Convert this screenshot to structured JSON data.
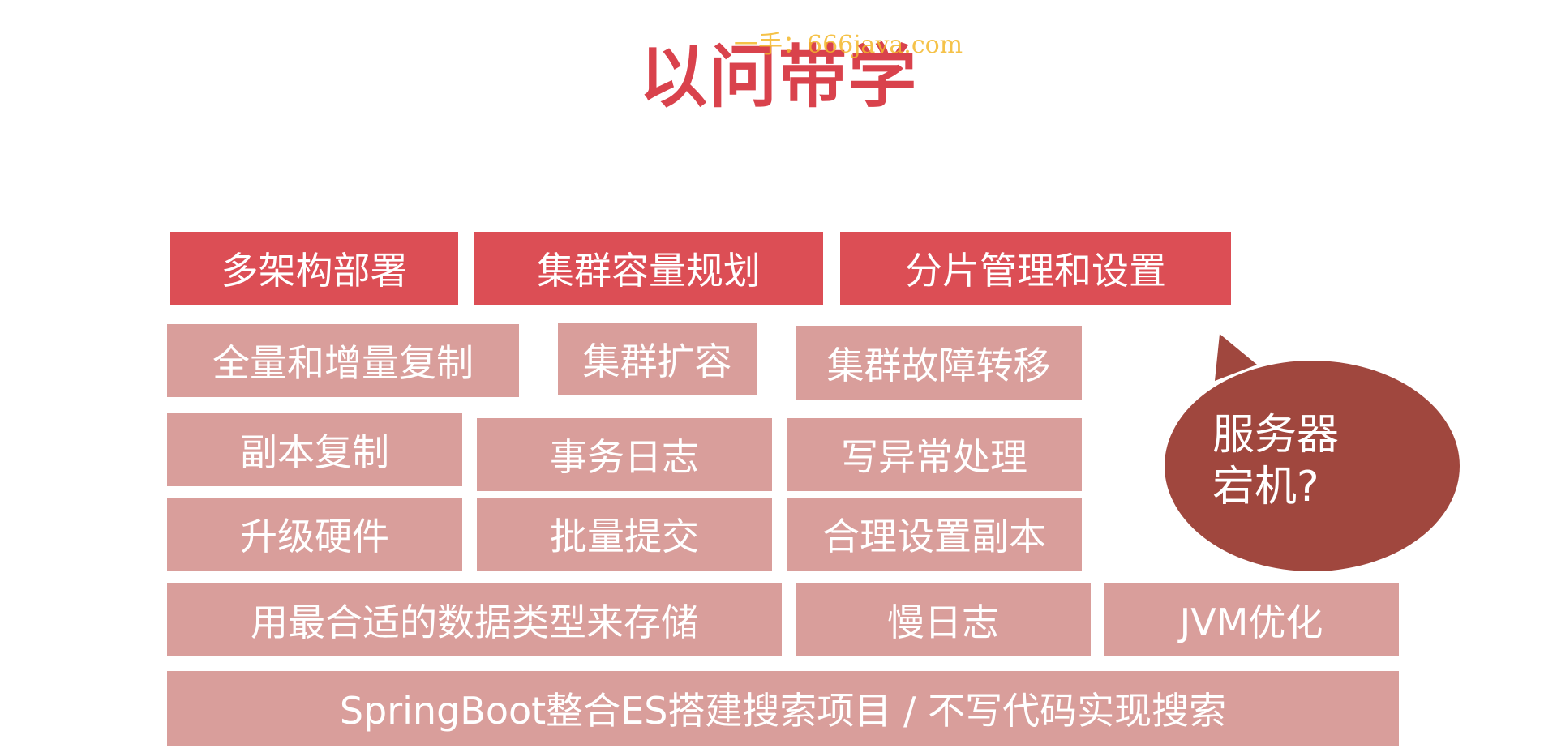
{
  "title": "以问带学",
  "watermark": "一手：666java.com",
  "colors": {
    "accent": "#dc4e55",
    "light_box": "#d99e9b",
    "bubble": "#a0473e",
    "watermark": "#f4b82a"
  },
  "rows": {
    "row1": [
      "多架构部署",
      "集群容量规划",
      "分片管理和设置"
    ],
    "row2": [
      "全量和增量复制",
      "集群扩容",
      "集群故障转移"
    ],
    "row3": [
      "副本复制",
      "事务日志",
      "写异常处理"
    ],
    "row4": [
      "升级硬件",
      "批量提交",
      "合理设置副本"
    ],
    "row5": [
      "用最合适的数据类型来存储",
      "慢日志",
      "JVM优化"
    ],
    "row6": [
      "SpringBoot整合ES搭建搜索项目 / 不写代码实现搜索"
    ]
  },
  "bubble": {
    "line1": "服务器",
    "line2": "宕机?"
  }
}
